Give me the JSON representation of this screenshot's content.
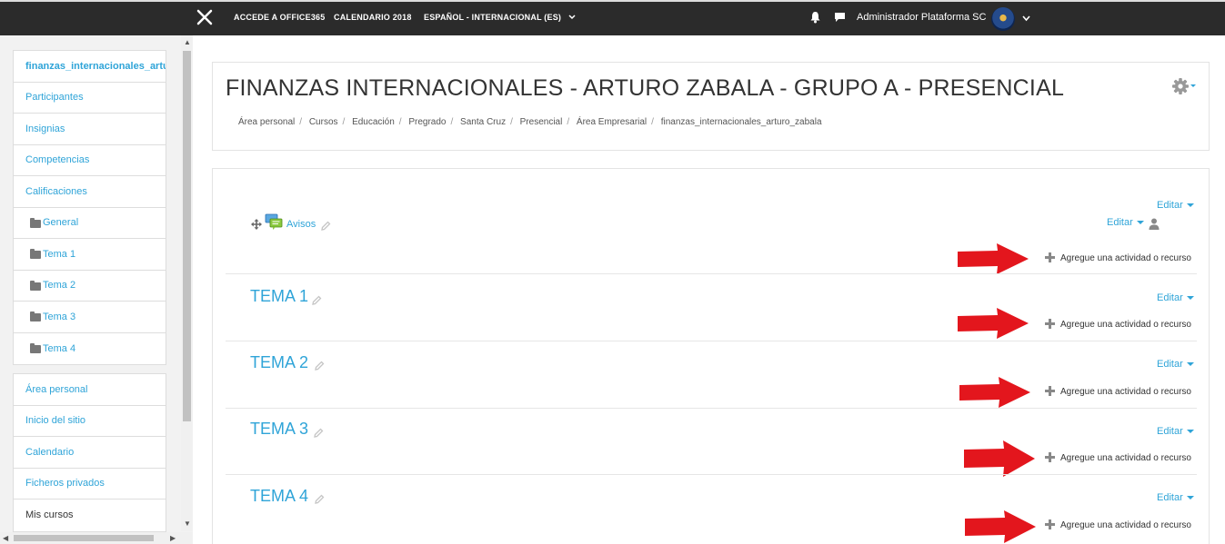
{
  "topbar": {
    "links": [
      "ACCEDE A OFFICE365",
      "CALENDARIO 2018",
      "ESPAÑOL - INTERNACIONAL (ES)"
    ],
    "user_name": "Administrador Plataforma SC"
  },
  "drawer": {
    "course_items": [
      "finanzas_internacionales_arturo_zabala",
      "Participantes",
      "Insignias",
      "Competencias",
      "Calificaciones",
      "General",
      "Tema 1",
      "Tema 2",
      "Tema 3",
      "Tema 4"
    ],
    "site_items": [
      "Área personal",
      "Inicio del sitio",
      "Calendario",
      "Ficheros privados",
      "Mis cursos"
    ]
  },
  "header": {
    "title": "FINANZAS INTERNACIONALES - ARTURO ZABALA - GRUPO A - PRESENCIAL",
    "breadcrumb": [
      "Área personal",
      "Cursos",
      "Educación",
      "Pregrado",
      "Santa Cruz",
      "Presencial",
      "Área Empresarial",
      "finanzas_internacionales_arturo_zabala"
    ]
  },
  "course": {
    "edit_label": "Editar",
    "add_label": "Agregue una actividad o recurso",
    "forum_name": "Avisos",
    "sections": [
      "TEMA 1",
      "TEMA 2",
      "TEMA 3",
      "TEMA 4"
    ]
  },
  "colors": {
    "accent": "#2fa4d8",
    "navbar": "#2b2b2b",
    "arrow": "#e3161d"
  }
}
